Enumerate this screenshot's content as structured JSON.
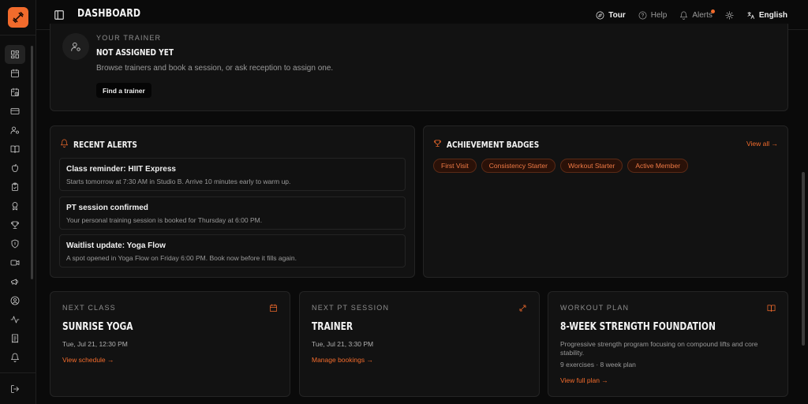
{
  "header": {
    "title": "DASHBOARD",
    "tour_label": "Tour",
    "help_label": "Help",
    "alerts_label": "Alerts",
    "language_label": "English"
  },
  "sidebar": {
    "items": [
      {
        "icon": "grid-icon",
        "active": true
      },
      {
        "icon": "calendar-icon"
      },
      {
        "icon": "calendar-clock-icon"
      },
      {
        "icon": "credit-card-icon"
      },
      {
        "icon": "user-settings-icon"
      },
      {
        "icon": "book-icon"
      },
      {
        "icon": "apple-icon"
      },
      {
        "icon": "clipboard-check-icon"
      },
      {
        "icon": "award-icon"
      },
      {
        "icon": "trophy-icon"
      },
      {
        "icon": "shield-icon"
      },
      {
        "icon": "video-icon"
      },
      {
        "icon": "megaphone-icon"
      },
      {
        "icon": "user-circle-icon"
      },
      {
        "icon": "activity-icon"
      },
      {
        "icon": "receipt-icon"
      },
      {
        "icon": "bell-icon"
      }
    ]
  },
  "trainer": {
    "eyebrow": "YOUR TRAINER",
    "title": "NOT ASSIGNED YET",
    "description": "Browse trainers and book a session, or ask reception to assign one.",
    "button": "Find a trainer"
  },
  "recent_alerts": {
    "title": "RECENT ALERTS",
    "items": [
      {
        "title": "Class reminder: HIIT Express",
        "body": "Starts tomorrow at 7:30 AM in Studio B. Arrive 10 minutes early to warm up."
      },
      {
        "title": "PT session confirmed",
        "body": "Your personal training session is booked for Thursday at 6:00 PM."
      },
      {
        "title": "Waitlist update: Yoga Flow",
        "body": "A spot opened in Yoga Flow on Friday 6:00 PM. Book now before it fills again."
      }
    ]
  },
  "badges": {
    "title": "ACHIEVEMENT BADGES",
    "view_all": "View all →",
    "items": [
      "First Visit",
      "Consistency Starter",
      "Workout Starter",
      "Active Member"
    ]
  },
  "next_class": {
    "eyebrow": "NEXT CLASS",
    "title": "SUNRISE YOGA",
    "datetime": "Tue, Jul 21, 12:30 PM",
    "link": "View schedule →"
  },
  "next_pt": {
    "eyebrow": "NEXT PT SESSION",
    "title": "TRAINER",
    "datetime": "Tue, Jul 21, 3:30 PM",
    "link": "Manage bookings →"
  },
  "workout_plan": {
    "eyebrow": "WORKOUT PLAN",
    "title": "8-WEEK STRENGTH FOUNDATION",
    "description": "Progressive strength program focusing on compound lifts and core stability.",
    "meta": "9 exercises · 8 week plan",
    "link": "View full plan →"
  },
  "colors": {
    "accent": "#f26b2c",
    "background": "#0a0a0a",
    "card": "#121212"
  }
}
